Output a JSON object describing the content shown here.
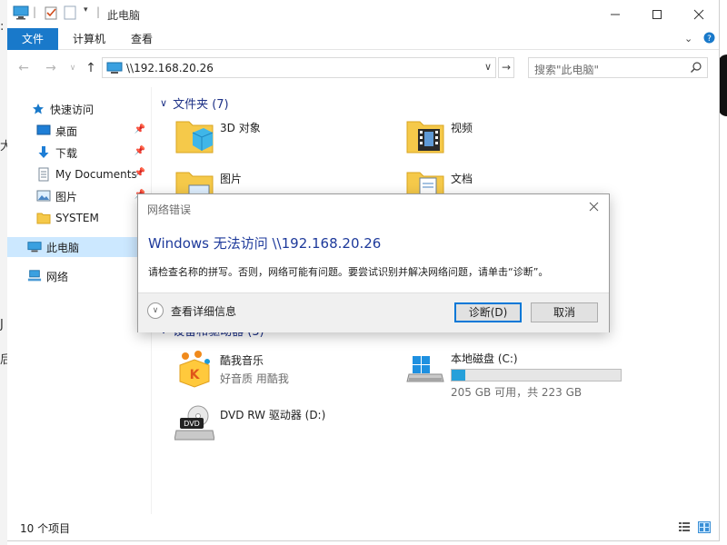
{
  "window": {
    "title": "此电脑"
  },
  "ribbon": {
    "tabs": [
      "文件",
      "计算机",
      "查看"
    ]
  },
  "address": {
    "path": "\\\\192.168.20.26",
    "search_placeholder": "搜索\"此电脑\""
  },
  "nav": {
    "quick_access": "快速访问",
    "items": [
      "桌面",
      "下载",
      "My Documents",
      "图片",
      "SYSTEM"
    ],
    "this_pc": "此电脑",
    "network": "网络"
  },
  "content": {
    "folders_group": "文件夹 (7)",
    "folders": [
      "3D 对象",
      "视频",
      "图片",
      "文档"
    ],
    "devices_group": "设备和驱动器 (3)",
    "devices": [
      {
        "name": "酷我音乐",
        "sub": "好音质 用酷我"
      },
      {
        "name": "本地磁盘 (C:)",
        "sub": "205 GB 可用，共 223 GB",
        "used_fraction": 0.08
      },
      {
        "name": "DVD RW 驱动器 (D:)"
      }
    ]
  },
  "status": {
    "count": "10 个项目"
  },
  "dialog": {
    "title": "网络错误",
    "heading": "Windows 无法访问 \\\\192.168.20.26",
    "message": "请检查名称的拼写。否则，网络可能有问题。要尝试识别并解决网络问题，请单击“诊断”。",
    "details": "查看详细信息",
    "diagnose": "诊断(D)",
    "cancel": "取消"
  }
}
